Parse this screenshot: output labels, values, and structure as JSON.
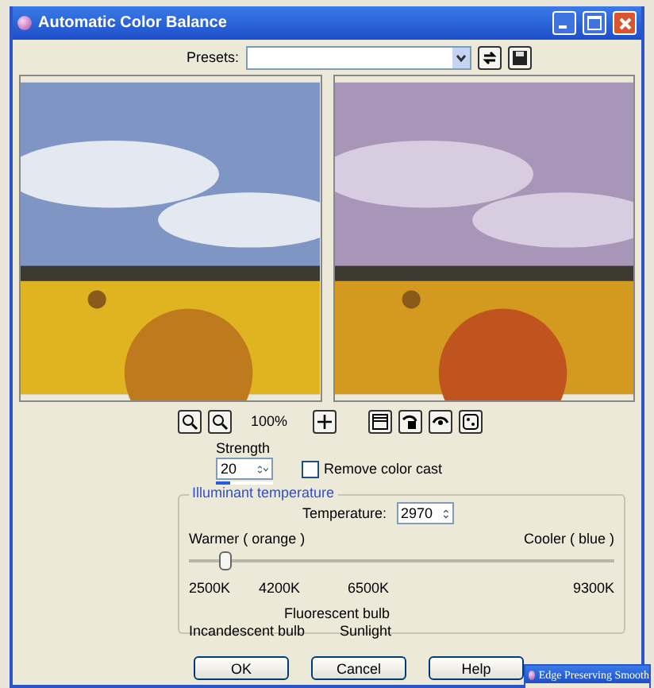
{
  "window": {
    "title": "Automatic Color Balance"
  },
  "presets": {
    "label": "Presets:"
  },
  "zoom": {
    "value": "100%"
  },
  "strength": {
    "label": "Strength",
    "value": "20",
    "level": 0.25
  },
  "remove_color_cast": {
    "label": "Remove color cast",
    "checked": false
  },
  "illuminant": {
    "title": "Illuminant temperature",
    "temperature_label": "Temperature:",
    "temperature_value": "2970",
    "warmer_label": "Warmer ( orange )",
    "cooler_label": "Cooler ( blue )",
    "level": 0.07,
    "ticks": [
      "2500K",
      "4200K",
      "6500K",
      "9300K"
    ],
    "markers": [
      {
        "label": "Fluorescent bulb",
        "kind": "upper"
      },
      {
        "label": "Incandescent bulb",
        "kind": "lower"
      },
      {
        "label": "Sunlight",
        "kind": "lower"
      }
    ]
  },
  "buttons": [
    "OK",
    "Cancel",
    "Help"
  ],
  "background_window": {
    "title": "Edge Preserving Smooth"
  }
}
